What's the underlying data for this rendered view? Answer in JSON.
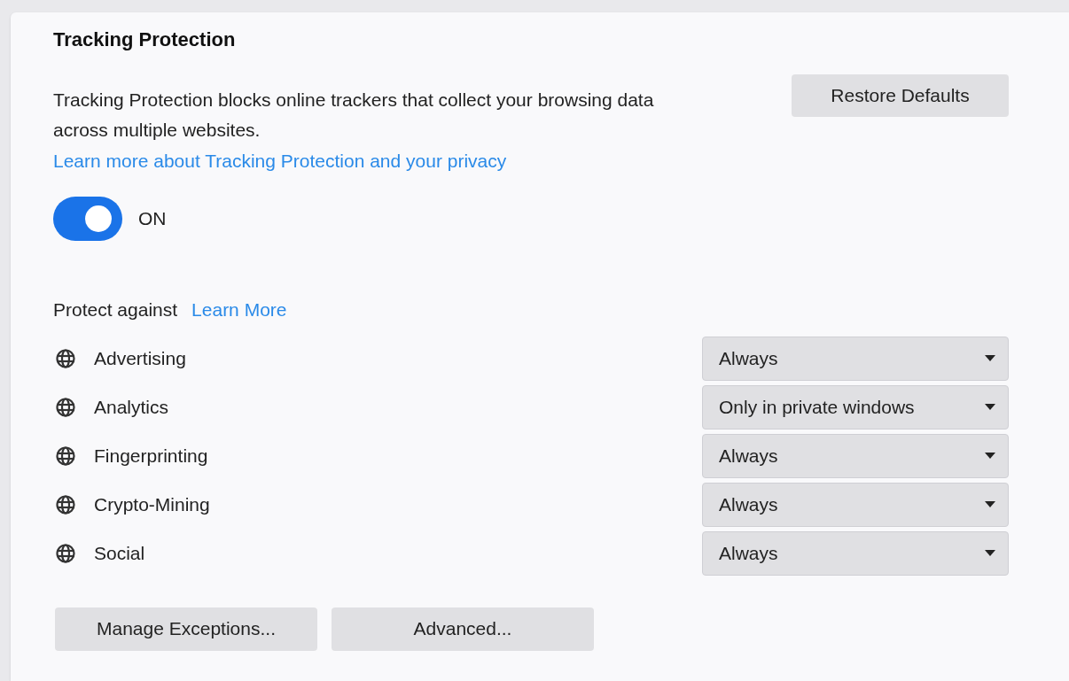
{
  "section": {
    "title": "Tracking Protection",
    "description": "Tracking Protection blocks online trackers that collect your browsing data across multiple websites.",
    "learn_link": "Learn more about Tracking Protection and your privacy",
    "restore_button": "Restore Defaults"
  },
  "toggle": {
    "on": true,
    "label": "ON"
  },
  "protect": {
    "label": "Protect against",
    "link": "Learn More"
  },
  "trackers": [
    {
      "name": "Advertising",
      "value": "Always"
    },
    {
      "name": "Analytics",
      "value": "Only in private windows"
    },
    {
      "name": "Fingerprinting",
      "value": "Always"
    },
    {
      "name": "Crypto-Mining",
      "value": "Always"
    },
    {
      "name": "Social",
      "value": "Always"
    }
  ],
  "buttons": [
    "Manage Exceptions...",
    "Advanced..."
  ]
}
